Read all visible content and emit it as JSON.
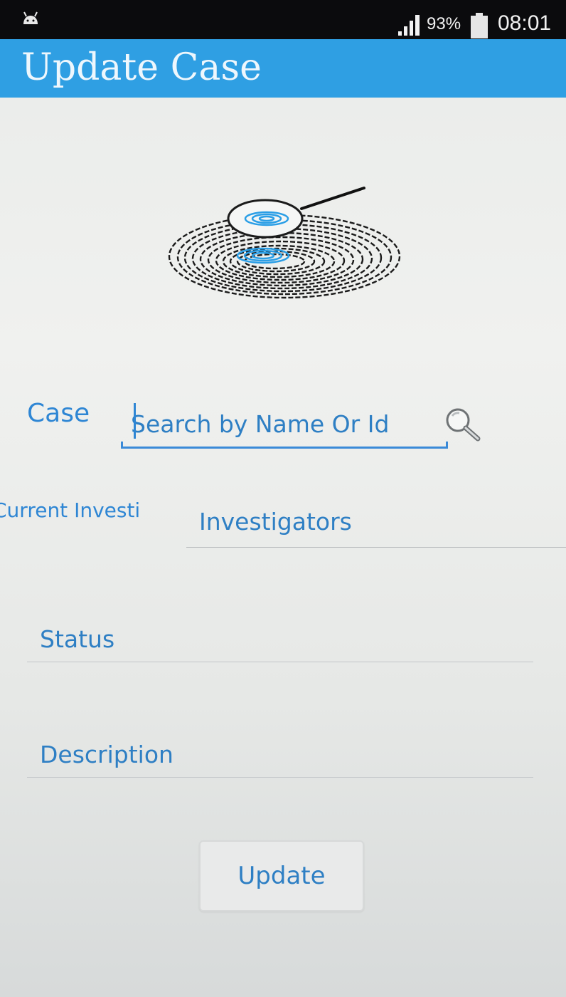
{
  "status_bar": {
    "battery_percent": "93%",
    "time": "08:01",
    "icons": [
      "android-icon",
      "signal-icon",
      "battery-icon"
    ]
  },
  "app_bar": {
    "title": "Update Case"
  },
  "logo": {
    "icon": "fingerprint-magnifier-icon"
  },
  "form": {
    "case": {
      "label": "Case",
      "placeholder": "Search by Name Or Id",
      "value": "",
      "icon": "search-icon"
    },
    "investigators": {
      "label": "Current Investi",
      "selected": "Investigators"
    },
    "status": {
      "placeholder": "Status",
      "value": ""
    },
    "description": {
      "placeholder": "Description",
      "value": ""
    },
    "update_button": "Update"
  },
  "colors": {
    "app_bar": "#2f9fe3",
    "accent_text": "#2e86d4",
    "status_bar": "#0b0b0d"
  }
}
